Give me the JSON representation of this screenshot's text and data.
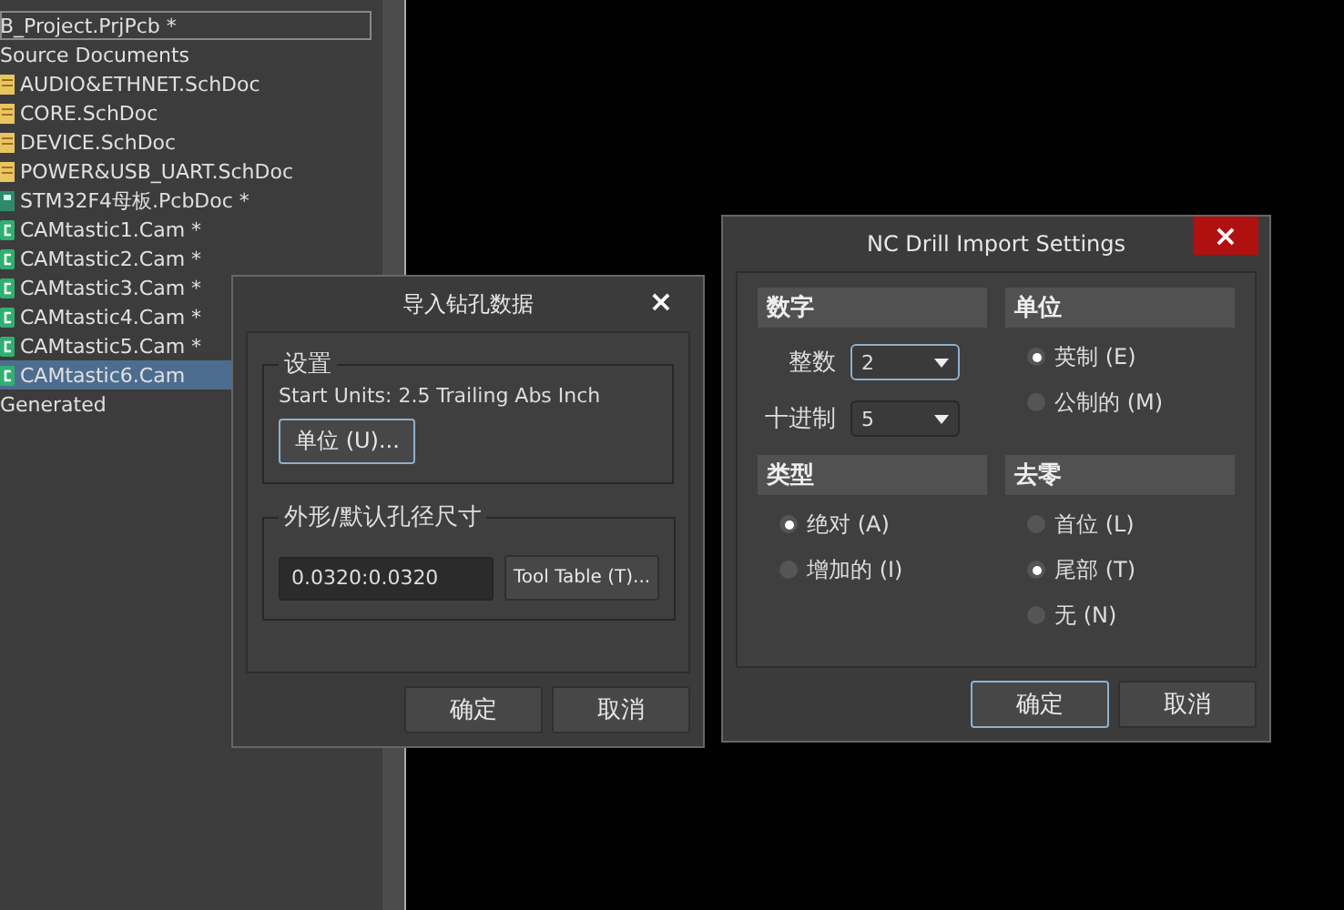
{
  "project_tree": {
    "project": {
      "label": "B_Project.PrjPcb *",
      "focused": true
    },
    "folders": [
      {
        "label": "Source Documents",
        "children": [
          {
            "label": "AUDIO&ETHNET.SchDoc",
            "kind": "sch",
            "selected": false
          },
          {
            "label": "CORE.SchDoc",
            "kind": "sch",
            "selected": false
          },
          {
            "label": "DEVICE.SchDoc",
            "kind": "sch",
            "selected": false
          },
          {
            "label": "POWER&USB_UART.SchDoc",
            "kind": "sch",
            "selected": false
          },
          {
            "label": "STM32F4母板.PcbDoc *",
            "kind": "pcb",
            "selected": false
          },
          {
            "label": "CAMtastic1.Cam *",
            "kind": "cam",
            "selected": false
          },
          {
            "label": "CAMtastic2.Cam *",
            "kind": "cam",
            "selected": false
          },
          {
            "label": "CAMtastic3.Cam *",
            "kind": "cam",
            "selected": false
          },
          {
            "label": "CAMtastic4.Cam *",
            "kind": "cam",
            "selected": false
          },
          {
            "label": "CAMtastic5.Cam *",
            "kind": "cam",
            "selected": false
          },
          {
            "label": "CAMtastic6.Cam",
            "kind": "cam",
            "selected": true
          }
        ]
      },
      {
        "label": "Generated"
      }
    ]
  },
  "import_dialog": {
    "title": "导入钻孔数据",
    "close": "×",
    "settings": {
      "legend": "设置",
      "info": "Start Units: 2.5 Trailing Abs Inch",
      "button": "单位 (U)..."
    },
    "aperture": {
      "legend": "外形/默认孔径尺寸",
      "value": "0.0320:0.0320",
      "button": "Tool Table (T)..."
    },
    "buttons": [
      {
        "label": "确定",
        "focused": false
      },
      {
        "label": "取消",
        "focused": false
      }
    ]
  },
  "nc_dialog": {
    "title": "NC Drill Import Settings",
    "close": "×",
    "digits": {
      "header": "数字",
      "fields": [
        {
          "label": "整数",
          "value": "2",
          "focused": true
        },
        {
          "label": "十进制",
          "value": "5",
          "focused": false
        }
      ]
    },
    "units": {
      "header": "单位",
      "options": [
        {
          "label": "英制 (E)",
          "selected": true
        },
        {
          "label": "公制的 (M)",
          "selected": false
        }
      ]
    },
    "type": {
      "header": "类型",
      "options": [
        {
          "label": "绝对 (A)",
          "selected": true
        },
        {
          "label": "增加的 (I)",
          "selected": false
        }
      ]
    },
    "zeros": {
      "header": "去零",
      "options": [
        {
          "label": "首位 (L)",
          "selected": false
        },
        {
          "label": "尾部 (T)",
          "selected": true
        },
        {
          "label": "无 (N)",
          "selected": false
        }
      ]
    },
    "buttons": [
      {
        "label": "确定",
        "focused": true
      },
      {
        "label": "取消",
        "focused": false
      }
    ]
  }
}
